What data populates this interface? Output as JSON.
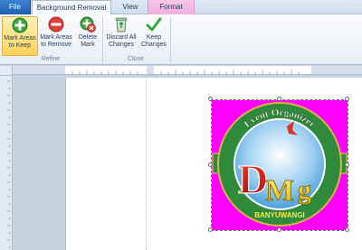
{
  "tabs": {
    "file": "File",
    "background_removal": "Background Removal",
    "view": "View",
    "format": "Format"
  },
  "ribbon": {
    "mark_keep": [
      "Mark Areas",
      "to Keep"
    ],
    "mark_remove": [
      "Mark Areas",
      "to Remove"
    ],
    "delete_mark": [
      "Delete",
      "Mark"
    ],
    "discard_all": [
      "Discard All",
      "Changes"
    ],
    "keep_changes": [
      "Keep",
      "Changes"
    ],
    "groups": {
      "refine": "Refine",
      "close": "Close"
    }
  },
  "logo": {
    "top_text": "Event Organizer",
    "letters": {
      "d": "D",
      "m": "M",
      "g": "g"
    },
    "bottom_text": "BANYUWANGI"
  },
  "colors": {
    "accent": "#2b579a",
    "file_tab": "#2f6fc3",
    "context_tab": "#efb0de",
    "magenta_bg": "#ff00ff",
    "ring_green": "#2f8a3b"
  }
}
